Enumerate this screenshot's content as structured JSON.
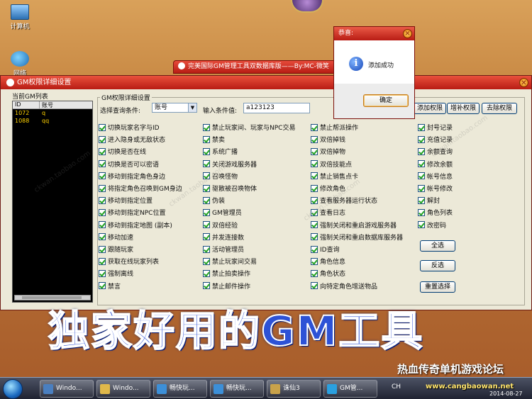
{
  "desktop": {
    "icons": [
      {
        "label": "计算机"
      },
      {
        "label": "网络"
      }
    ]
  },
  "background_window": {
    "title": "完美国际GM管理工具双数据库版——By:MC-微笑"
  },
  "window": {
    "title": "GM权限详细设置",
    "close": "✕",
    "gm_list_label": "当前GM列表",
    "gm_list_headers": [
      "ID",
      "账号"
    ],
    "gm_list_rows": [
      {
        "id": "1072",
        "account": "q"
      },
      {
        "id": "1088",
        "account": "qq"
      }
    ],
    "group_title": "GM权限详细设置",
    "query_label": "选择查询条件:",
    "query_value": "账号",
    "condition_label": "输入条件值:",
    "condition_value": "a123123",
    "buttons": {
      "add": "添加权限",
      "supplement": "增补权限",
      "remove": "去除权限",
      "select_all": "全选",
      "invert": "反选",
      "reset": "重置选择"
    },
    "permissions": {
      "col1": [
        "切换玩家名字与ID",
        "进入隐身或无敌状态",
        "切换是否在线",
        "切换是否可以密语",
        "移动到指定角色身边",
        "将指定角色召唤到GM身边",
        "移动到指定位置",
        "移动到指定NPC位置",
        "移动到指定地图 (副本)",
        "移动加速",
        "跟随玩家",
        "获取在线玩家列表",
        "强制离线",
        "禁言"
      ],
      "col2": [
        "禁止玩家间、玩家与NPC交易",
        "禁卖",
        "系统广播",
        "关闭游戏服务器",
        "召唤怪物",
        "驱散被召唤物体",
        "伪装",
        "GM管理员",
        "双倍经验",
        "并发连接数",
        "活动管理员",
        "禁止玩家间交易",
        "禁止拍卖操作",
        "禁止邮件操作"
      ],
      "col3": [
        "禁止帮派操作",
        "双倍掉钱",
        "双倍掉物",
        "双倍技能点",
        "禁止销售点卡",
        "修改角色",
        "查看服务器运行状态",
        "查看日志",
        "强制关闭和重启游戏服务器",
        "强制关闭和重启数据库服务器",
        "ID查询",
        "角色信息",
        "角色状态",
        "向特定角色增送物品"
      ],
      "col4": [
        "封号记录",
        "充值记录",
        "余额查询",
        "修改余额",
        "帐号信息",
        "帐号修改",
        "解封",
        "角色列表",
        "改密码"
      ]
    }
  },
  "dialog": {
    "title": "恭喜:",
    "close": "✕",
    "message": "添加成功",
    "ok": "确定"
  },
  "overlay": {
    "banner": "独家好用的GM工具",
    "brand": "热血传奇单机游戏论坛",
    "url": "www.cangbaowan.net",
    "date": "2014-08-27"
  },
  "taskbar": {
    "items": [
      "Windo...",
      "Windo...",
      "畅快玩...",
      "畅快玩...",
      "诛仙3",
      "GM管..."
    ],
    "lang": "CH"
  }
}
